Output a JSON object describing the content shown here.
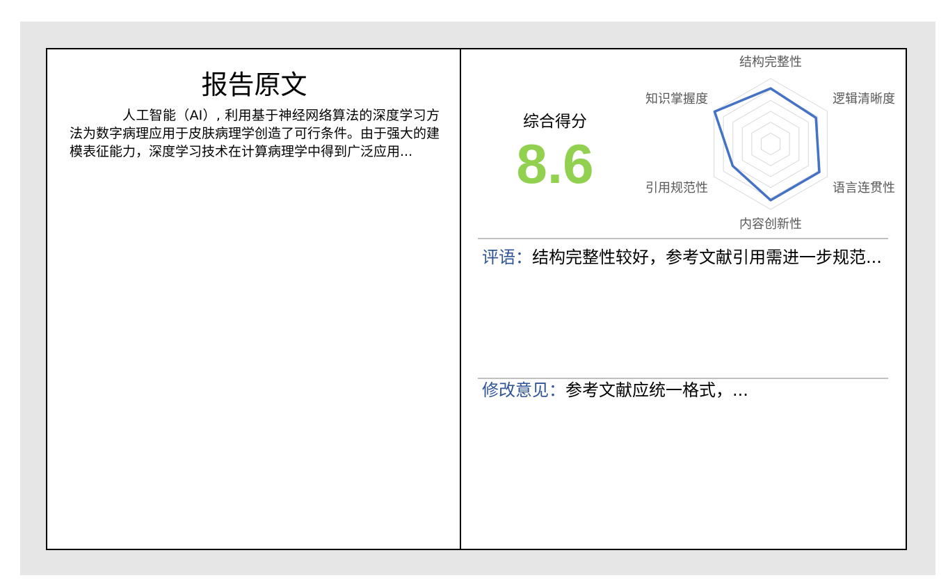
{
  "report": {
    "title": "报告原文",
    "body": "人工智能（AI）, 利用基于神经网络算法的深度学习方法为数字病理应用于皮肤病理学创造了可行条件。由于强大的建模表征能力，深度学习技术在计算病理学中得到广泛应用..."
  },
  "score": {
    "label": "综合得分",
    "value": "8.6",
    "color": "#92d050"
  },
  "chart_data": {
    "type": "radar",
    "axes": [
      "结构完整性",
      "逻辑清晰度",
      "语言连贯性",
      "内容创新性",
      "引用规范性",
      "知识掌握度"
    ],
    "values": [
      8.5,
      8.0,
      8.6,
      8.6,
      6.7,
      9.9
    ],
    "range": [
      0,
      10
    ],
    "rings": 6,
    "series_color": "#4472c4",
    "grid_color": "#d9d9d9"
  },
  "comment": {
    "label": "评语：",
    "text": "结构完整性较好，参考文献引用需进一步规范..."
  },
  "suggestion": {
    "label": "修改意见：",
    "text": "参考文献应统一格式，..."
  }
}
